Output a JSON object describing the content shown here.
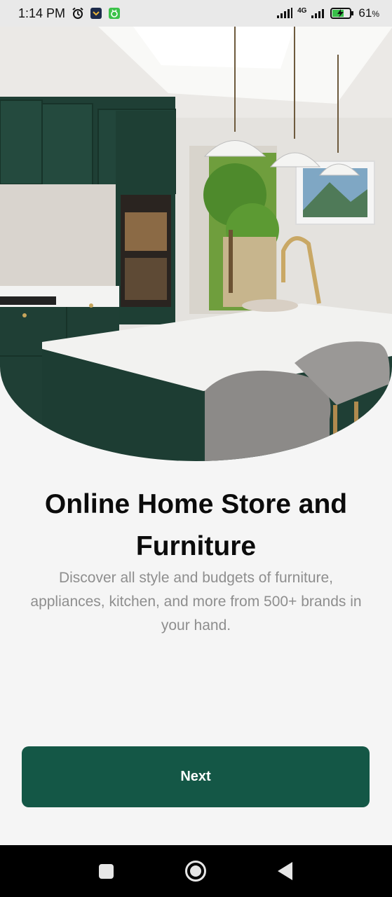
{
  "status_bar": {
    "time": "1:14 PM",
    "network": "4G",
    "battery": "61",
    "battery_unit": "%"
  },
  "hero": {
    "image": "kitchen-interior-photo"
  },
  "content": {
    "title": "Online Home Store and Furniture",
    "subtitle": "Discover all style and budgets of furniture, appliances, kitchen, and more from 500+ brands in your hand."
  },
  "next_button": {
    "label": "Next"
  },
  "colors": {
    "accent": "#145746",
    "background": "#f5f5f5",
    "subtitle": "#8e8e8e"
  },
  "nav_bar": {
    "icons": [
      "recent-apps-icon",
      "home-icon",
      "back-icon"
    ]
  }
}
